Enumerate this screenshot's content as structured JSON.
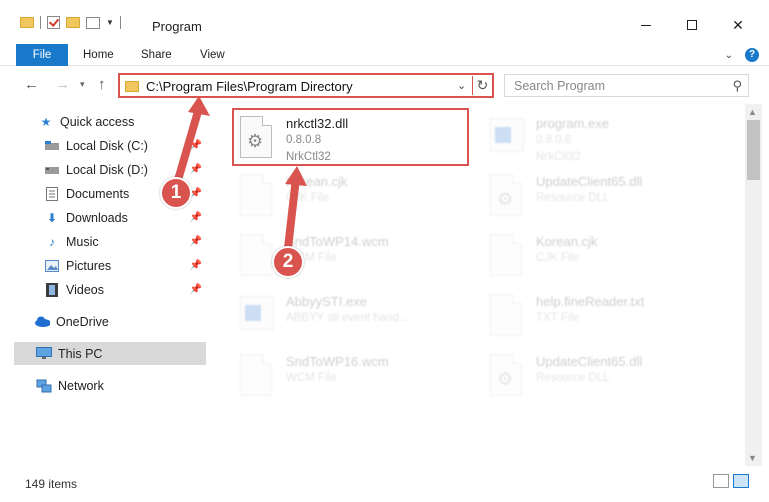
{
  "window": {
    "title": "Program"
  },
  "ribbon": {
    "tabs": [
      "File",
      "Home",
      "Share",
      "View"
    ],
    "help": "?"
  },
  "address_bar": {
    "path": "C:\\Program Files\\Program Directory"
  },
  "search": {
    "placeholder": "Search Program"
  },
  "sidebar": {
    "items": [
      {
        "label": "Quick access",
        "icon": "star-icon",
        "pinned": false
      },
      {
        "label": "Local Disk (C:)",
        "icon": "drive-icon",
        "pinned": true
      },
      {
        "label": "Local Disk (D:)",
        "icon": "drive-icon",
        "pinned": true
      },
      {
        "label": "Documents",
        "icon": "documents-icon",
        "pinned": true
      },
      {
        "label": "Downloads",
        "icon": "download-icon",
        "pinned": true
      },
      {
        "label": "Music",
        "icon": "music-icon",
        "pinned": true
      },
      {
        "label": "Pictures",
        "icon": "pictures-icon",
        "pinned": true
      },
      {
        "label": "Videos",
        "icon": "videos-icon",
        "pinned": true
      },
      {
        "label": "OneDrive",
        "icon": "cloud-icon",
        "pinned": false
      },
      {
        "label": "This PC",
        "icon": "monitor-icon",
        "pinned": false,
        "selected": true
      },
      {
        "label": "Network",
        "icon": "network-icon",
        "pinned": false
      }
    ]
  },
  "files": [
    {
      "name": "nrkctl32.dll",
      "line2": "0.8.0.8",
      "line3": "NrkCtl32",
      "highlighted": true
    },
    {
      "name": "program.exe",
      "line2": "0.8.0.8",
      "line3": "NrkCtl32",
      "faded": true
    },
    {
      "name": "Korean.cjk",
      "line2": "CJK File",
      "faded": true
    },
    {
      "name": "UpdateClient65.dll",
      "line2": "Resource DLL",
      "faded": true
    },
    {
      "name": "SndToWP14.wcm",
      "line2": "WCM File",
      "faded": true
    },
    {
      "name": "Korean.cjk",
      "line2": "CJK File",
      "faded": true
    },
    {
      "name": "AbbyySTI.exe",
      "line2": "ABBYY sti event hand...",
      "faded": true
    },
    {
      "name": "help.fineReader.txt",
      "line2": "TXT File",
      "faded": true
    },
    {
      "name": "SndToWP16.wcm",
      "line2": "WCM File",
      "faded": true
    },
    {
      "name": "UpdateClient65.dll",
      "line2": "Resource DLL",
      "faded": true
    }
  ],
  "status": {
    "item_count": "149 items"
  },
  "annotations": {
    "badge1": "1",
    "badge2": "2",
    "color": "#d9534f"
  }
}
